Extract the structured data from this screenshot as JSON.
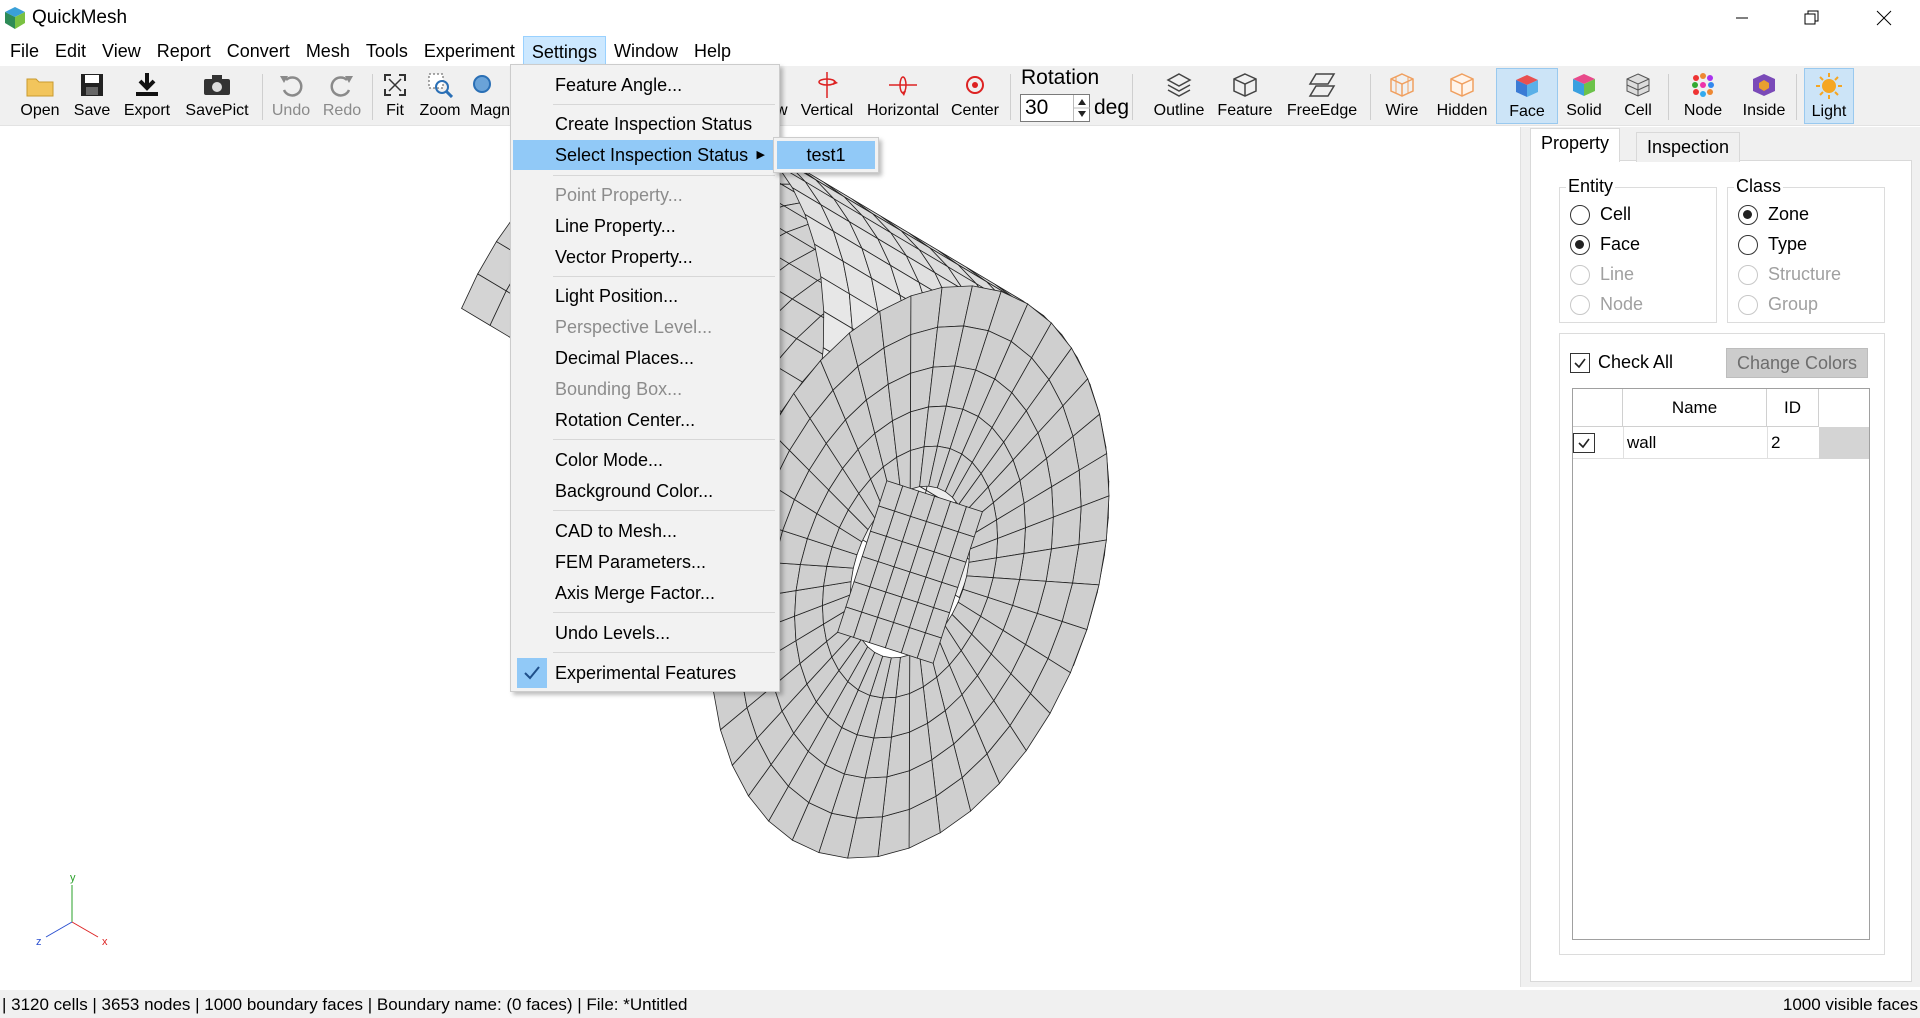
{
  "window": {
    "title": "QuickMesh"
  },
  "menubar": [
    "File",
    "Edit",
    "View",
    "Report",
    "Convert",
    "Mesh",
    "Tools",
    "Experiment",
    "Settings",
    "Window",
    "Help"
  ],
  "toolbar": {
    "open": "Open",
    "save": "Save",
    "export": "Export",
    "savepict": "SavePict",
    "undo": "Undo",
    "redo": "Redo",
    "fit": "Fit",
    "zoom": "Zoom",
    "magnify": "Magn",
    "view_partial": "w",
    "vertical": "Vertical",
    "horizontal": "Horizontal",
    "center": "Center",
    "rotation_label": "Rotation",
    "rotation_value": "30",
    "rotation_unit": "deg",
    "outline": "Outline",
    "feature": "Feature",
    "freeedge": "FreeEdge",
    "wire": "Wire",
    "hidden": "Hidden",
    "face": "Face",
    "solid": "Solid",
    "cell": "Cell",
    "node": "Node",
    "inside": "Inside",
    "light": "Light",
    "more": "»"
  },
  "settings_menu": {
    "items": [
      "Feature Angle...",
      "Create Inspection Status",
      "Select Inspection Status",
      "Point Property...",
      "Line Property...",
      "Vector Property...",
      "Light Position...",
      "Perspective Level...",
      "Decimal Places...",
      "Bounding Box...",
      "Rotation Center...",
      "Color Mode...",
      "Background Color...",
      "CAD to Mesh...",
      "FEM Parameters...",
      "Axis Merge Factor...",
      "Undo Levels...",
      "Experimental Features"
    ],
    "submenu_item": "test1"
  },
  "axes": {
    "y": "y",
    "z": "z",
    "x": "x"
  },
  "panel": {
    "tabs": [
      "Property",
      "Inspection"
    ],
    "entity": {
      "title": "Entity",
      "options": [
        "Cell",
        "Face",
        "Line",
        "Node"
      ],
      "selected": "Face"
    },
    "class": {
      "title": "Class",
      "options": [
        "Zone",
        "Type",
        "Structure",
        "Group"
      ],
      "selected": "Zone"
    },
    "check_all": "Check All",
    "change_colors": "Change Colors",
    "table": {
      "headers": [
        "Name",
        "ID"
      ],
      "rows": [
        {
          "name": "wall",
          "id": "2",
          "checked": true
        }
      ]
    }
  },
  "status": {
    "left": "| 3120 cells | 3653 nodes | 1000 boundary faces |  Boundary name:  (0 faces) | File: *Untitled",
    "right": "1000 visible faces"
  }
}
